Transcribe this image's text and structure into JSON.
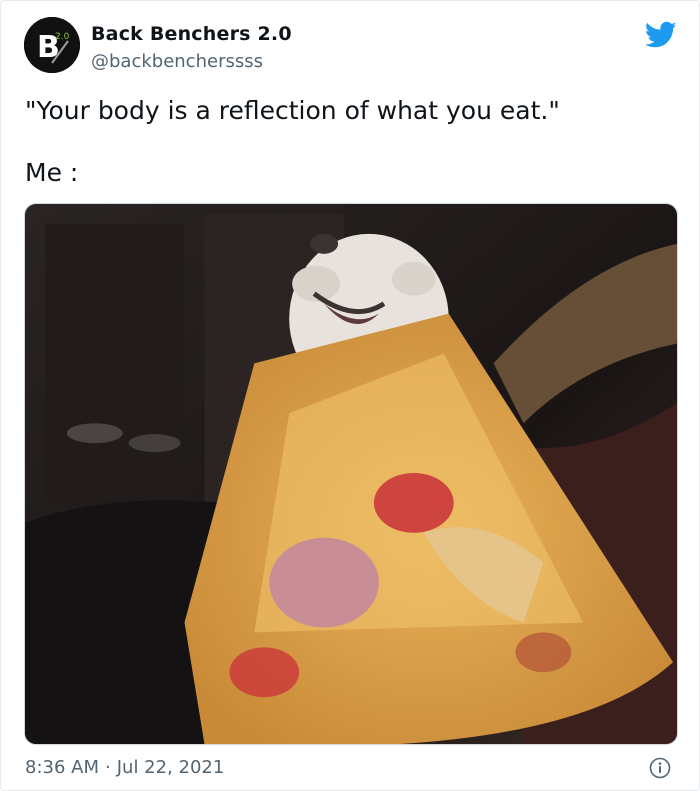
{
  "author": {
    "display_name": "Back Benchers 2.0",
    "handle": "@backbencherssss",
    "avatar_icon": "back-benchers-logo",
    "avatar_text": "B",
    "avatar_badge": "2.0"
  },
  "tweet": {
    "line_1": "\"Your body is a reflection of what you eat.\"",
    "line_2": "Me :"
  },
  "media": {
    "description_icon": "photo-dog-wearing-pizza-slice"
  },
  "footer": {
    "time": "8:36 AM",
    "separator": "·",
    "date": "Jul 22, 2021"
  },
  "icons": {
    "brand": "twitter-bird-icon",
    "info": "info-icon"
  },
  "colors": {
    "twitter_blue": "#1d9bf0",
    "text_primary": "#0f1419",
    "text_secondary": "#536471"
  }
}
